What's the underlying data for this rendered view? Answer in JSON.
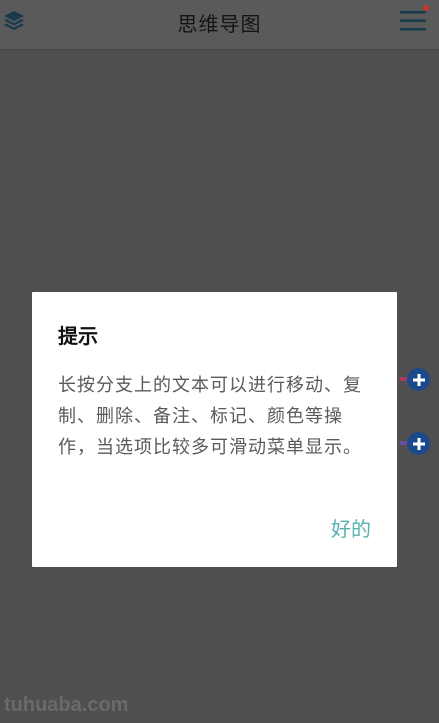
{
  "header": {
    "title": "思维导图",
    "left_icon": "layers-icon",
    "right_icon": "menu-icon"
  },
  "dialog": {
    "title": "提示",
    "message": "长按分支上的文本可以进行移动、复制、删除、备注、标记、颜色等操作，当选项比较多可滑动菜单显示。",
    "ok_label": "好的"
  },
  "watermark": "tuhuaba.com",
  "colors": {
    "accent": "#5ab0b0",
    "branch_top": "#a83b63",
    "branch_bottom": "#6a4fa0",
    "plus_button": "#1a4a8c",
    "notification_dot": "#c0392b"
  }
}
